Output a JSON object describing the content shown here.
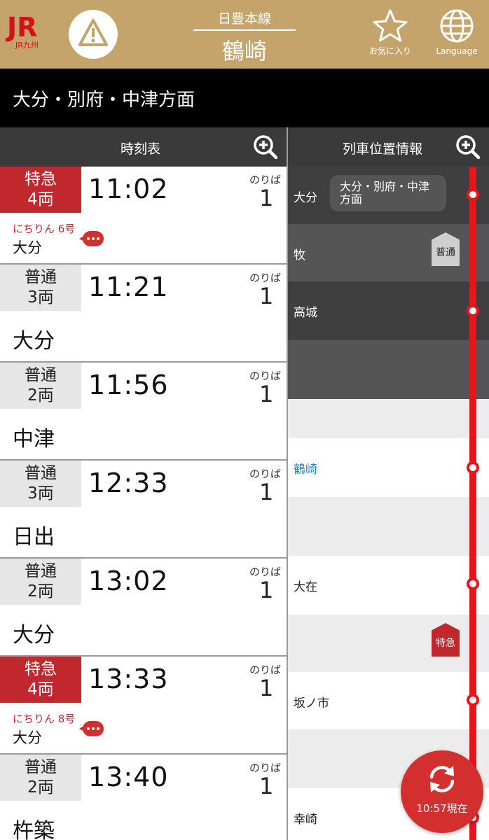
{
  "header": {
    "logo_text": "JR",
    "logo_sub": "JR九州",
    "line_name": "日豊本線",
    "station_name": "鶴崎",
    "favorite_label": "お気に入り",
    "language_label": "Language",
    "brand_color": "#c4a46a"
  },
  "direction": "大分・別府・中津方面",
  "timetable_header": "時刻表",
  "position_header": "列車位置情報",
  "noriba_label": "のりば",
  "trains": [
    {
      "type": "特急",
      "cars": "4両",
      "express": true,
      "time": "11:02",
      "platform": "1",
      "train_name": "にちりん 6号",
      "destination": "大分"
    },
    {
      "type": "普通",
      "cars": "3両",
      "express": false,
      "time": "11:21",
      "platform": "1",
      "train_name": "",
      "destination": "大分"
    },
    {
      "type": "普通",
      "cars": "2両",
      "express": false,
      "time": "11:56",
      "platform": "1",
      "train_name": "",
      "destination": "中津"
    },
    {
      "type": "普通",
      "cars": "3両",
      "express": false,
      "time": "12:33",
      "platform": "1",
      "train_name": "",
      "destination": "日出"
    },
    {
      "type": "普通",
      "cars": "2両",
      "express": false,
      "time": "13:02",
      "platform": "1",
      "train_name": "",
      "destination": "大分"
    },
    {
      "type": "特急",
      "cars": "4両",
      "express": true,
      "time": "13:33",
      "platform": "1",
      "train_name": "にちりん 8号",
      "destination": "大分"
    },
    {
      "type": "普通",
      "cars": "2両",
      "express": false,
      "time": "13:40",
      "platform": "1",
      "train_name": "",
      "destination": "杵築"
    }
  ],
  "position": {
    "direction_pill": "大分・別府・中津方面",
    "stations": [
      {
        "name": "大分"
      },
      {
        "name": "牧"
      },
      {
        "name": "高城"
      },
      {
        "name": "鶴崎"
      },
      {
        "name": "大在"
      },
      {
        "name": "坂ノ市"
      },
      {
        "name": "幸崎"
      }
    ],
    "train_tags": [
      {
        "label": "普通"
      },
      {
        "label": "特急"
      }
    ]
  },
  "refresh_label": "10:57現在"
}
